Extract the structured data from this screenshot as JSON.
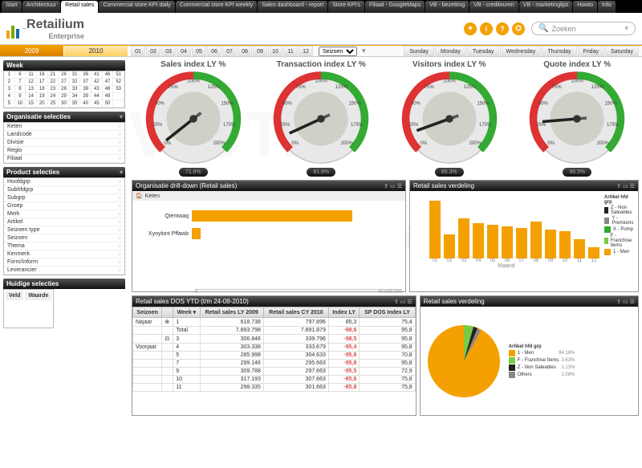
{
  "tabs": [
    "Start",
    "Architectuur",
    "Retail sales",
    "Commercial store KPI daily",
    "Commercial store KPI weekly",
    "Sales dashboard - report",
    "Store KPI's",
    "Filiaal - GoogleMaps",
    "VB - bezetting",
    "VB - crediteuren",
    "VB - marketinglijst",
    "Howto",
    "Info"
  ],
  "active_tab": 2,
  "logo": {
    "name": "Retailium",
    "sub": "Enterprise"
  },
  "search_placeholder": "Zoeken",
  "years": [
    "2009",
    "2010"
  ],
  "months": [
    "01",
    "02",
    "03",
    "04",
    "05",
    "06",
    "07",
    "08",
    "09",
    "10",
    "11",
    "12"
  ],
  "season_label": "Seizoen",
  "days": [
    "Sunday",
    "Monday",
    "Tuesday",
    "Wednesday",
    "Thursday",
    "Friday",
    "Saturday"
  ],
  "side": {
    "week": {
      "title": "Week",
      "cells": [
        1,
        6,
        11,
        16,
        21,
        26,
        31,
        36,
        41,
        46,
        51,
        2,
        7,
        12,
        17,
        22,
        27,
        32,
        37,
        42,
        47,
        52,
        3,
        8,
        13,
        18,
        23,
        28,
        33,
        38,
        43,
        48,
        53,
        4,
        9,
        14,
        19,
        24,
        29,
        34,
        39,
        44,
        49,
        "",
        5,
        10,
        15,
        20,
        25,
        30,
        35,
        40,
        45,
        50,
        ""
      ]
    },
    "org": {
      "title": "Organisatie selecties",
      "rows": [
        "Keten",
        "Landcode",
        "Divisie",
        "Regio",
        "Filiaal"
      ]
    },
    "prod": {
      "title": "Product selecties",
      "rows": [
        "Hoofdgrp",
        "Subhfdgrp",
        "Subgrp",
        "Groep",
        "Merk",
        "Artikel",
        "Seizoen type",
        "Seizoen",
        "Thema",
        "Kenmerk",
        "Form/Inform",
        "Leverancier"
      ]
    },
    "curr": {
      "title": "Huidige selecties",
      "cols": [
        "Veld",
        "Waarde"
      ]
    }
  },
  "gauges": [
    {
      "title": "Sales index LY %",
      "value": "71.6%"
    },
    {
      "title": "Transaction index LY %",
      "value": "81.8%"
    },
    {
      "title": "Visitors index LY %",
      "value": "85.3%"
    },
    {
      "title": "Quote index LY %",
      "value": "96.5%"
    }
  ],
  "gauge_ticks": [
    "0%",
    "25%",
    "50%",
    "75%",
    "100%",
    "125%",
    "150%",
    "175%",
    "200%"
  ],
  "drill": {
    "title": "Organisatie drill-down (Retail sales)",
    "level": "Keten",
    "rows": [
      {
        "name": "Qiemwaq",
        "v": 40000000
      },
      {
        "name": "Xyoylont Pffawb",
        "v": 2200000
      }
    ],
    "axis": [
      "0",
      "40.000.000"
    ]
  },
  "verdeling": {
    "title": "Retail sales verdeling",
    "legend_title": "Artikel hfd grp",
    "legend": [
      {
        "c": "#222",
        "n": "Z - Non Saleables"
      },
      {
        "c": "#888",
        "n": "Y - Premiums"
      },
      {
        "c": "#3a3",
        "n": "X - Pomp"
      },
      {
        "c": "#7c4",
        "n": "F - Franchise Items"
      },
      {
        "c": "#f4a000",
        "n": "1 - Men"
      }
    ],
    "x": "Maand"
  },
  "table": {
    "title": "Retail sales DOS YTD (t/m 24-08-2010)",
    "cols": [
      "Seizoen",
      "",
      "Week",
      "Retail sales LY 2009",
      "Retail sales CY 2010",
      "Index LY",
      "SP DOS Index LY"
    ],
    "rows": [
      [
        "Najaar",
        "⊕",
        "1",
        "618.738",
        "797.896",
        "85,3",
        "75,4"
      ],
      [
        "",
        "",
        "Total",
        "7.893.798",
        "7.891.879",
        "-98,6",
        "95,8"
      ],
      [
        "",
        "⊟",
        "3",
        "306.846",
        "339.796",
        "-98,5",
        "95,8"
      ],
      [
        "Voorjaar",
        "",
        "4",
        "303.338",
        "333.679",
        "-95,4",
        "95,8"
      ],
      [
        "",
        "",
        "5",
        "285.998",
        "304.633",
        "-95,6",
        "70,8"
      ],
      [
        "",
        "",
        "7",
        "299.146",
        "295.663",
        "-95,8",
        "95,8"
      ],
      [
        "",
        "",
        "9",
        "309.788",
        "297.663",
        "-95,5",
        "72,9"
      ],
      [
        "",
        "",
        "10",
        "317.193",
        "307.663",
        "-85,6",
        "75,8"
      ],
      [
        "",
        "",
        "11",
        "298.335",
        "301.663",
        "-85,8",
        "75,8"
      ]
    ]
  },
  "pie": {
    "title": "Retail sales verdeling",
    "legend_title": "Artikel hfd grp",
    "legend": [
      {
        "c": "#f4a000",
        "n": "1 - Men",
        "v": "94.16%"
      },
      {
        "c": "#7c4",
        "n": "F - Franchise Items",
        "v": "3.63%"
      },
      {
        "c": "#222",
        "n": "Z - Non Saleables",
        "v": "1.13%"
      },
      {
        "c": "#888",
        "n": "Others",
        "v": "1.08%"
      }
    ]
  },
  "chart_data": [
    {
      "type": "gauge",
      "title": "Sales index LY %",
      "value": 71.6,
      "range": [
        0,
        200
      ]
    },
    {
      "type": "gauge",
      "title": "Transaction index LY %",
      "value": 81.8,
      "range": [
        0,
        200
      ]
    },
    {
      "type": "gauge",
      "title": "Visitors index LY %",
      "value": 85.3,
      "range": [
        0,
        200
      ]
    },
    {
      "type": "gauge",
      "title": "Quote index LY %",
      "value": 96.5,
      "range": [
        0,
        200
      ]
    },
    {
      "type": "bar",
      "title": "Organisatie drill-down (Retail sales)",
      "orientation": "horizontal",
      "categories": [
        "Qiemwaq",
        "Xyoylont Pffawb"
      ],
      "values": [
        40000000,
        2200000
      ],
      "xlabel": "",
      "xlim": [
        0,
        40000000
      ]
    },
    {
      "type": "bar",
      "title": "Retail sales verdeling (bar)",
      "categories": [
        "01",
        "02",
        "03",
        "04",
        "05",
        "06",
        "07",
        "08",
        "09",
        "10",
        "11",
        "12"
      ],
      "series": [
        {
          "name": "1 - Men",
          "values": [
            90,
            38,
            62,
            55,
            52,
            50,
            48,
            58,
            45,
            42,
            30,
            18
          ]
        }
      ],
      "xlabel": "Maand",
      "ylabel": "%"
    },
    {
      "type": "pie",
      "title": "Retail sales verdeling (pie)",
      "categories": [
        "1 - Men",
        "F - Franchise Items",
        "Z - Non Saleables",
        "Others"
      ],
      "values": [
        94.16,
        3.63,
        1.13,
        1.08
      ]
    },
    {
      "type": "table",
      "title": "Retail sales DOS YTD (t/m 24-08-2010)",
      "columns": [
        "Seizoen",
        "Week",
        "Retail sales LY 2009",
        "Retail sales CY 2010",
        "Index LY",
        "SP DOS Index LY"
      ]
    }
  ],
  "watermark": "QlikView Solutions"
}
